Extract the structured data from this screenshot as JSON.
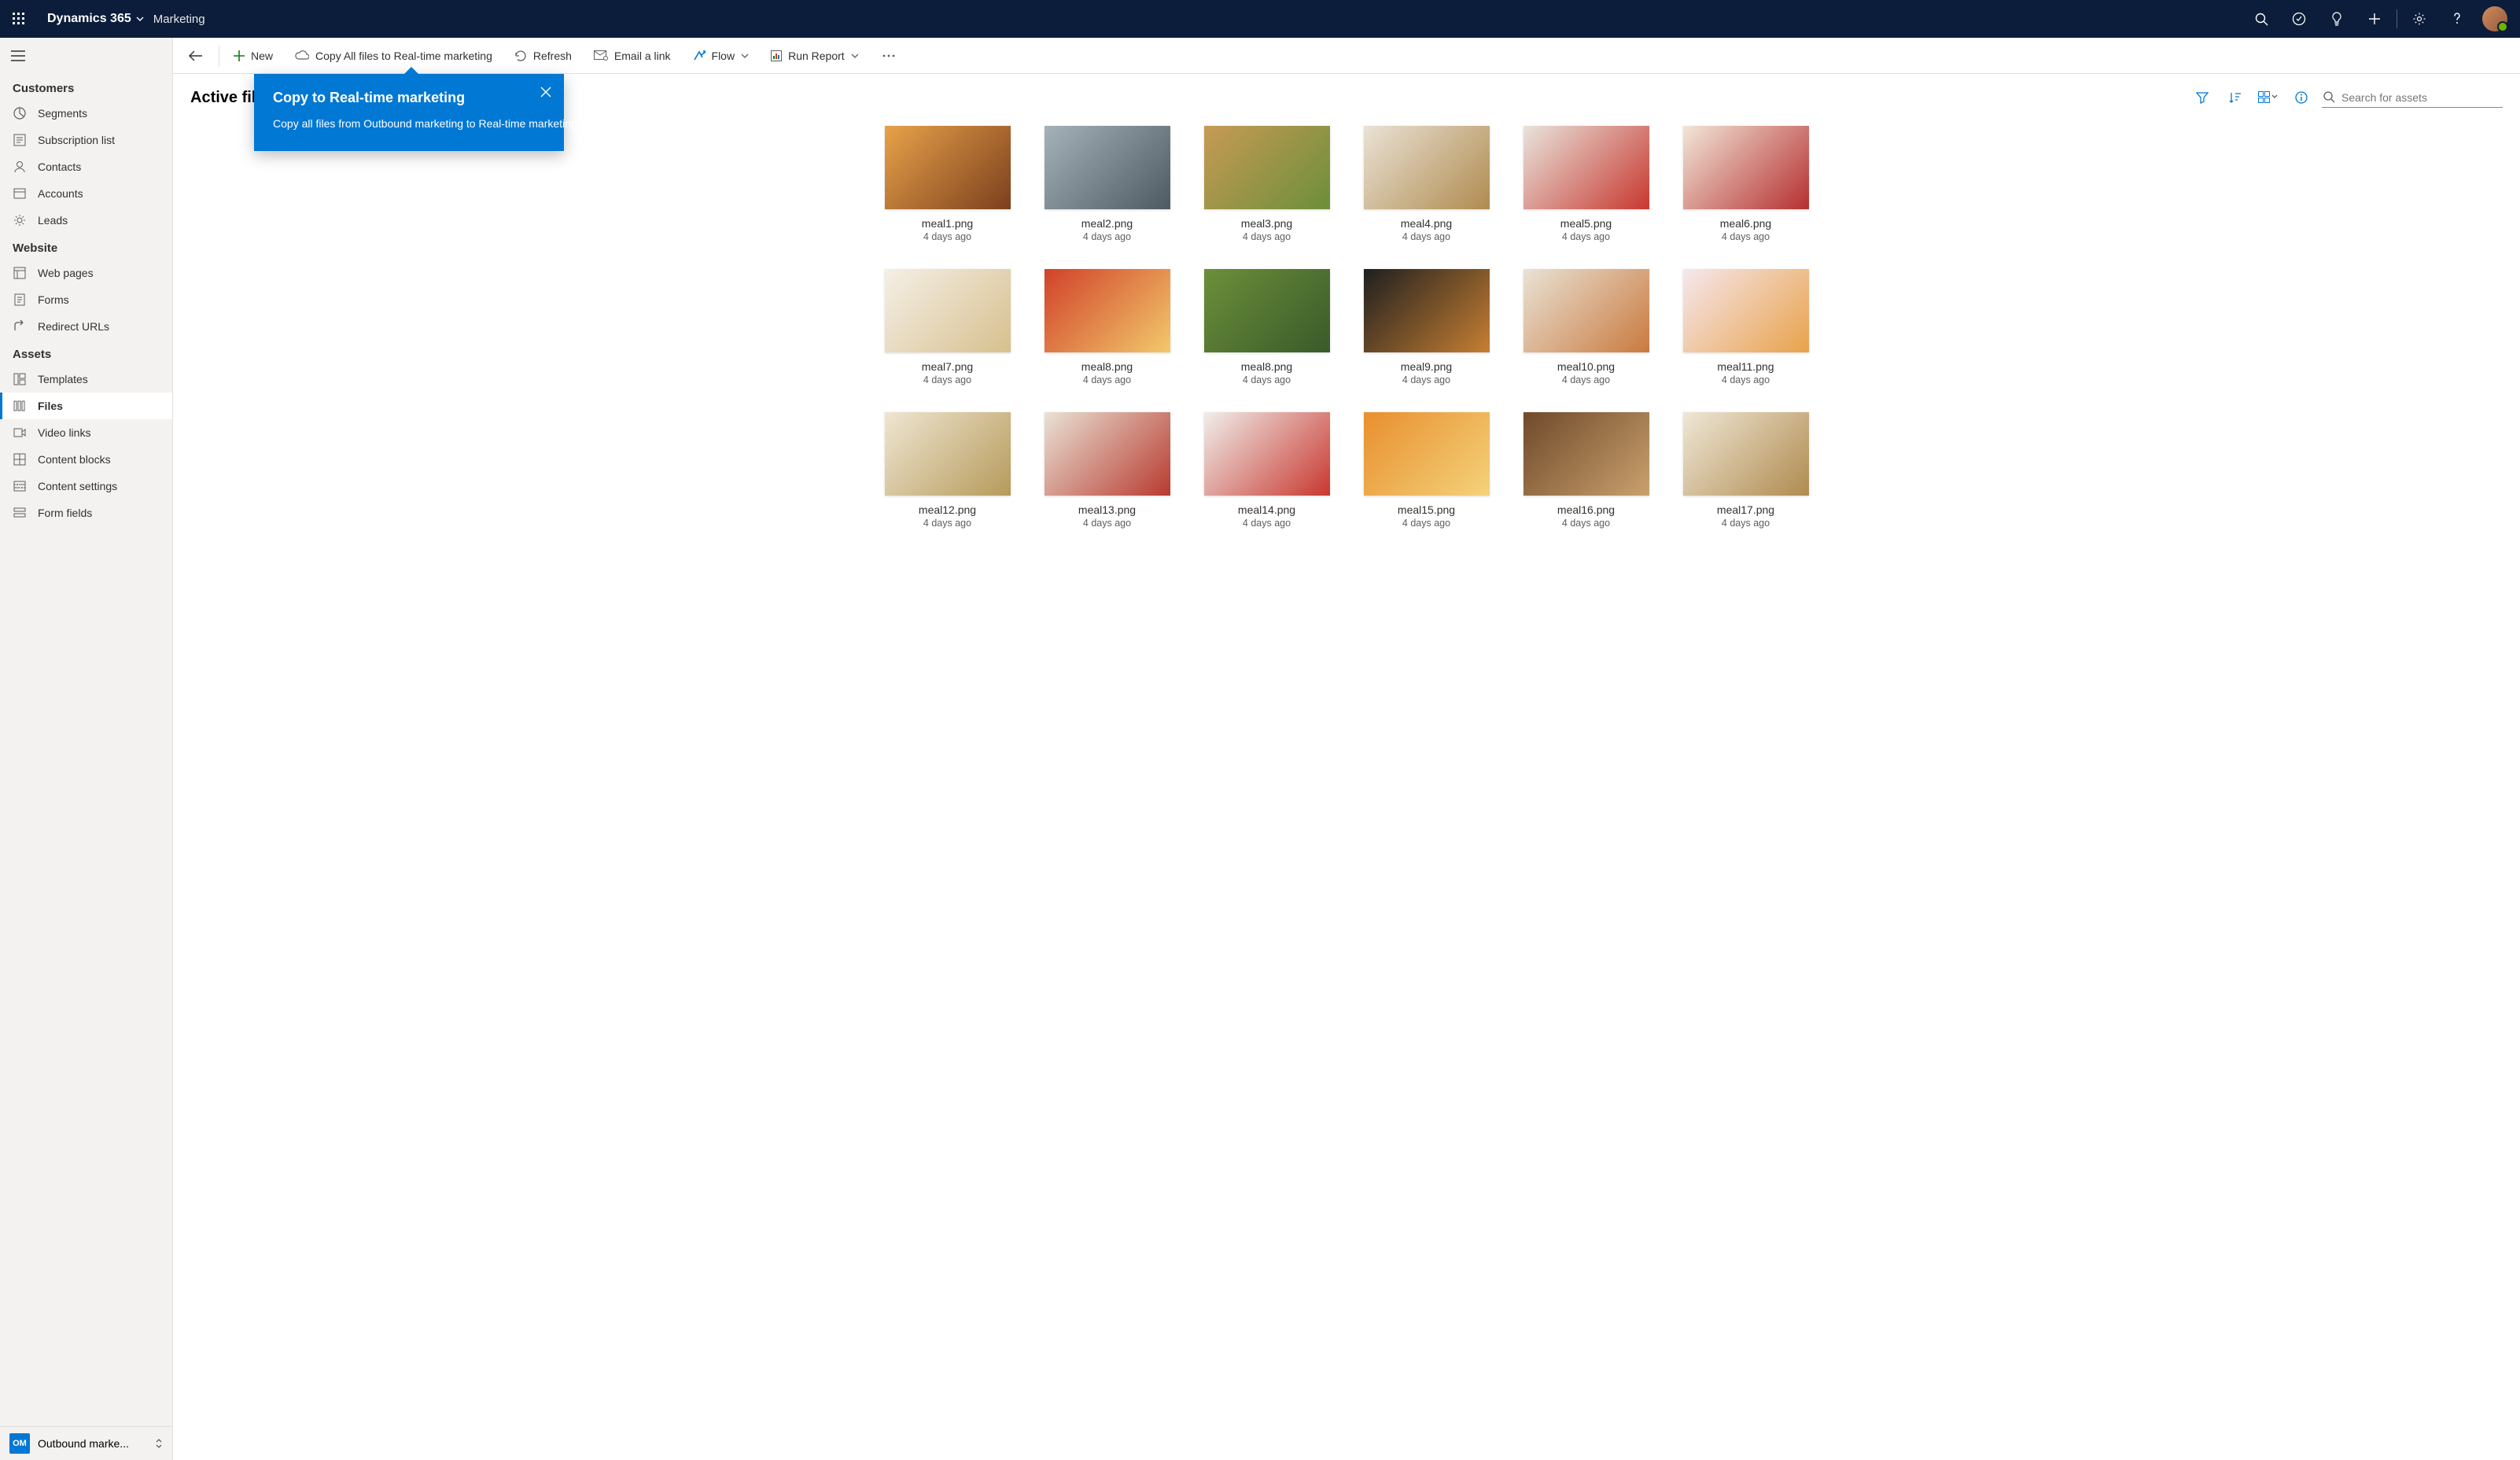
{
  "topbar": {
    "brand": "Dynamics 365",
    "module": "Marketing"
  },
  "sidebar": {
    "sections": [
      {
        "title": "Customers",
        "items": [
          {
            "icon": "segments-icon",
            "label": "Segments"
          },
          {
            "icon": "subscription-icon",
            "label": "Subscription list"
          },
          {
            "icon": "contacts-icon",
            "label": "Contacts"
          },
          {
            "icon": "accounts-icon",
            "label": "Accounts"
          },
          {
            "icon": "leads-icon",
            "label": "Leads"
          }
        ]
      },
      {
        "title": "Website",
        "items": [
          {
            "icon": "webpages-icon",
            "label": "Web pages"
          },
          {
            "icon": "forms-icon",
            "label": "Forms"
          },
          {
            "icon": "redirect-icon",
            "label": "Redirect URLs"
          }
        ]
      },
      {
        "title": "Assets",
        "items": [
          {
            "icon": "templates-icon",
            "label": "Templates"
          },
          {
            "icon": "files-icon",
            "label": "Files",
            "active": true
          },
          {
            "icon": "video-icon",
            "label": "Video links"
          },
          {
            "icon": "blocks-icon",
            "label": "Content blocks"
          },
          {
            "icon": "settings-icon",
            "label": "Content settings"
          },
          {
            "icon": "formfields-icon",
            "label": "Form fields"
          }
        ]
      }
    ],
    "footer": {
      "badge": "OM",
      "label": "Outbound marke..."
    }
  },
  "cmdbar": {
    "new": "New",
    "copy": "Copy All files to Real-time marketing",
    "refresh": "Refresh",
    "email": "Email a link",
    "flow": "Flow",
    "report": "Run Report"
  },
  "callout": {
    "title": "Copy to Real-time marketing",
    "body": "Copy all files from Outbound marketing to Real-time marketing at once or select files you want to copy."
  },
  "page": {
    "title": "Active files",
    "search_placeholder": "Search for assets"
  },
  "files": [
    {
      "name": "meal1.png",
      "date": "4 days ago",
      "g": "g1"
    },
    {
      "name": "meal2.png",
      "date": "4 days ago",
      "g": "g2"
    },
    {
      "name": "meal3.png",
      "date": "4 days ago",
      "g": "g3"
    },
    {
      "name": "meal4.png",
      "date": "4 days ago",
      "g": "g4"
    },
    {
      "name": "meal5.png",
      "date": "4 days ago",
      "g": "g5"
    },
    {
      "name": "meal6.png",
      "date": "4 days ago",
      "g": "g6"
    },
    {
      "name": "meal7.png",
      "date": "4 days ago",
      "g": "g7"
    },
    {
      "name": "meal8.png",
      "date": "4 days ago",
      "g": "g8"
    },
    {
      "name": "meal8.png",
      "date": "4 days ago",
      "g": "g9"
    },
    {
      "name": "meal9.png",
      "date": "4 days ago",
      "g": "g10"
    },
    {
      "name": "meal10.png",
      "date": "4 days ago",
      "g": "g11"
    },
    {
      "name": "meal11.png",
      "date": "4 days ago",
      "g": "g12"
    },
    {
      "name": "meal12.png",
      "date": "4 days ago",
      "g": "g13"
    },
    {
      "name": "meal13.png",
      "date": "4 days ago",
      "g": "g14"
    },
    {
      "name": "meal14.png",
      "date": "4 days ago",
      "g": "g15"
    },
    {
      "name": "meal15.png",
      "date": "4 days ago",
      "g": "g16"
    },
    {
      "name": "meal16.png",
      "date": "4 days ago",
      "g": "g17"
    },
    {
      "name": "meal17.png",
      "date": "4 days ago",
      "g": "g18"
    }
  ]
}
